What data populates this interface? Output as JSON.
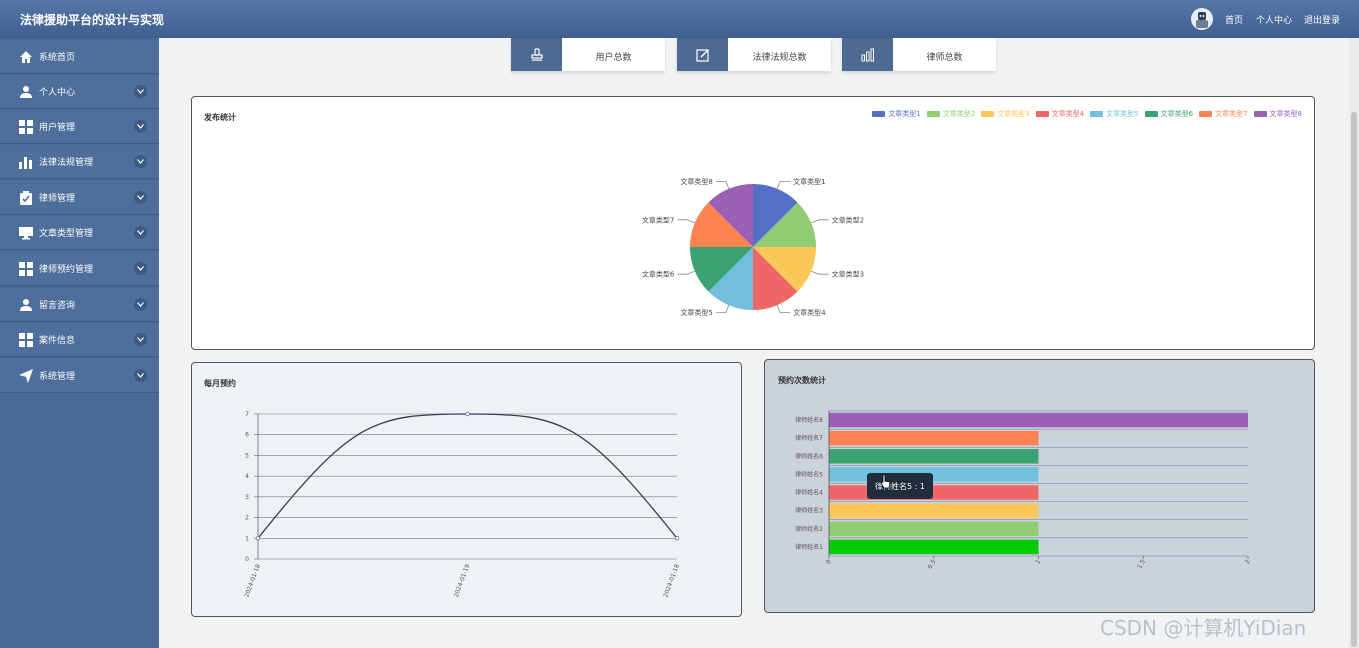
{
  "app": {
    "title": "法律援助平台的设计与实现"
  },
  "topnav": {
    "home": "首页",
    "profile": "个人中心",
    "logout": "退出登录"
  },
  "sidebar": {
    "items": [
      {
        "label": "系统首页",
        "icon": "home-icon"
      },
      {
        "label": "个人中心",
        "icon": "user-icon"
      },
      {
        "label": "用户管理",
        "icon": "grid-icon"
      },
      {
        "label": "法律法规管理",
        "icon": "bar-chart-icon"
      },
      {
        "label": "律师管理",
        "icon": "clipboard-check-icon"
      },
      {
        "label": "文章类型管理",
        "icon": "monitor-icon"
      },
      {
        "label": "律师预约管理",
        "icon": "grid-icon"
      },
      {
        "label": "留言咨询",
        "icon": "user-icon"
      },
      {
        "label": "案件信息",
        "icon": "grid-icon"
      },
      {
        "label": "系统管理",
        "icon": "send-icon"
      }
    ]
  },
  "stats": {
    "users": {
      "label": "用户总数",
      "icon": "stamp-icon"
    },
    "laws": {
      "label": "法律法规总数",
      "icon": "edit-icon"
    },
    "lawyers": {
      "label": "律师总数",
      "icon": "bar-chart-icon"
    }
  },
  "colors": {
    "palette": [
      "#5470c6",
      "#91cc75",
      "#fac858",
      "#ee6666",
      "#73c0de",
      "#3ba272",
      "#fc8452",
      "#9a60b4"
    ],
    "accent": "#4d6a92",
    "bar1": "#00cc00"
  },
  "chart_data": [
    {
      "type": "pie",
      "title": "发布统计",
      "categories": [
        "文章类型1",
        "文章类型2",
        "文章类型3",
        "文章类型4",
        "文章类型5",
        "文章类型6",
        "文章类型7",
        "文章类型8"
      ],
      "values": [
        1,
        1,
        1,
        1,
        1,
        1,
        1,
        1
      ],
      "legend": "top-right"
    },
    {
      "type": "line",
      "title": "每月预约",
      "x": [
        "2024-01-18",
        "2024-01-19",
        "2024-01-18"
      ],
      "x_tick_labels": [
        "2024-01-18",
        "2024-01-19",
        "2024-01-18"
      ],
      "values": [
        1,
        7,
        1
      ],
      "y_ticks": [
        "0",
        "1",
        "2",
        "3",
        "4",
        "5",
        "6",
        "7"
      ],
      "ylim": [
        0,
        7
      ],
      "grid": true
    },
    {
      "type": "bar",
      "orientation": "horizontal",
      "title": "预约次数统计",
      "categories": [
        "律师姓名1",
        "律师姓名2",
        "律师姓名3",
        "律师姓名4",
        "律师姓名5",
        "律师姓名6",
        "律师姓名7",
        "律师姓名8"
      ],
      "values": [
        1,
        1,
        1,
        1,
        1,
        1,
        1,
        2
      ],
      "x_ticks": [
        "0",
        "0.5",
        "1",
        "1.5",
        "2"
      ],
      "xlim": [
        0,
        2
      ],
      "tooltip": "律师姓名5 : 1"
    }
  ],
  "watermark": "CSDN @计算机YiDian"
}
